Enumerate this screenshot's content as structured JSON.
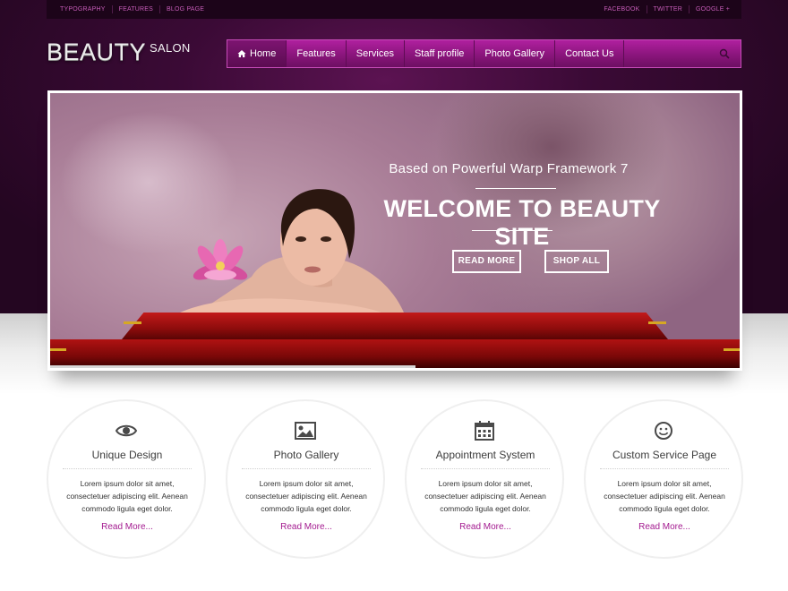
{
  "colors": {
    "accent": "#a3198f",
    "nav_gradient_top": "#b0209f",
    "header_dark": "#240621",
    "podium_red": "#b01212"
  },
  "toolbar": {
    "left_links": [
      "TYPOGRAPHY",
      "FEATURES",
      "BLOG PAGE"
    ],
    "right_links": [
      "FACEBOOK",
      "TWITTER",
      "GOOGLE +"
    ]
  },
  "logo": {
    "main": "BEAUTY",
    "sub": "SALON"
  },
  "nav": {
    "items": [
      {
        "label": "Home",
        "icon": "home-icon",
        "active": true
      },
      {
        "label": "Features"
      },
      {
        "label": "Services"
      },
      {
        "label": "Staff profile"
      },
      {
        "label": "Photo Gallery"
      },
      {
        "label": "Contact Us"
      }
    ],
    "search_icon": "search-icon"
  },
  "slide": {
    "subtitle": "Based on Powerful Warp Framework 7",
    "title": "WELCOME TO BEAUTY SITE",
    "buttons": [
      "READ MORE",
      "SHOP ALL"
    ],
    "progress": 0.53
  },
  "features": [
    {
      "icon": "eye-icon",
      "title": "Unique Design",
      "text": "Lorem ipsum dolor sit amet, consectetuer adipiscing elit. Aenean commodo ligula eget dolor.",
      "link": "Read More..."
    },
    {
      "icon": "image-icon",
      "title": "Photo Gallery",
      "text": "Lorem ipsum dolor sit amet, consectetuer adipiscing elit. Aenean commodo ligula eget dolor.",
      "link": "Read More..."
    },
    {
      "icon": "calendar-icon",
      "title": "Appointment System",
      "text": "Lorem ipsum dolor sit amet, consectetuer adipiscing elit. Aenean commodo ligula eget dolor.",
      "link": "Read More..."
    },
    {
      "icon": "smiley-icon",
      "title": "Custom Service Page",
      "text": "Lorem ipsum dolor sit amet, consectetuer adipiscing elit. Aenean commodo ligula eget dolor.",
      "link": "Read More..."
    }
  ]
}
